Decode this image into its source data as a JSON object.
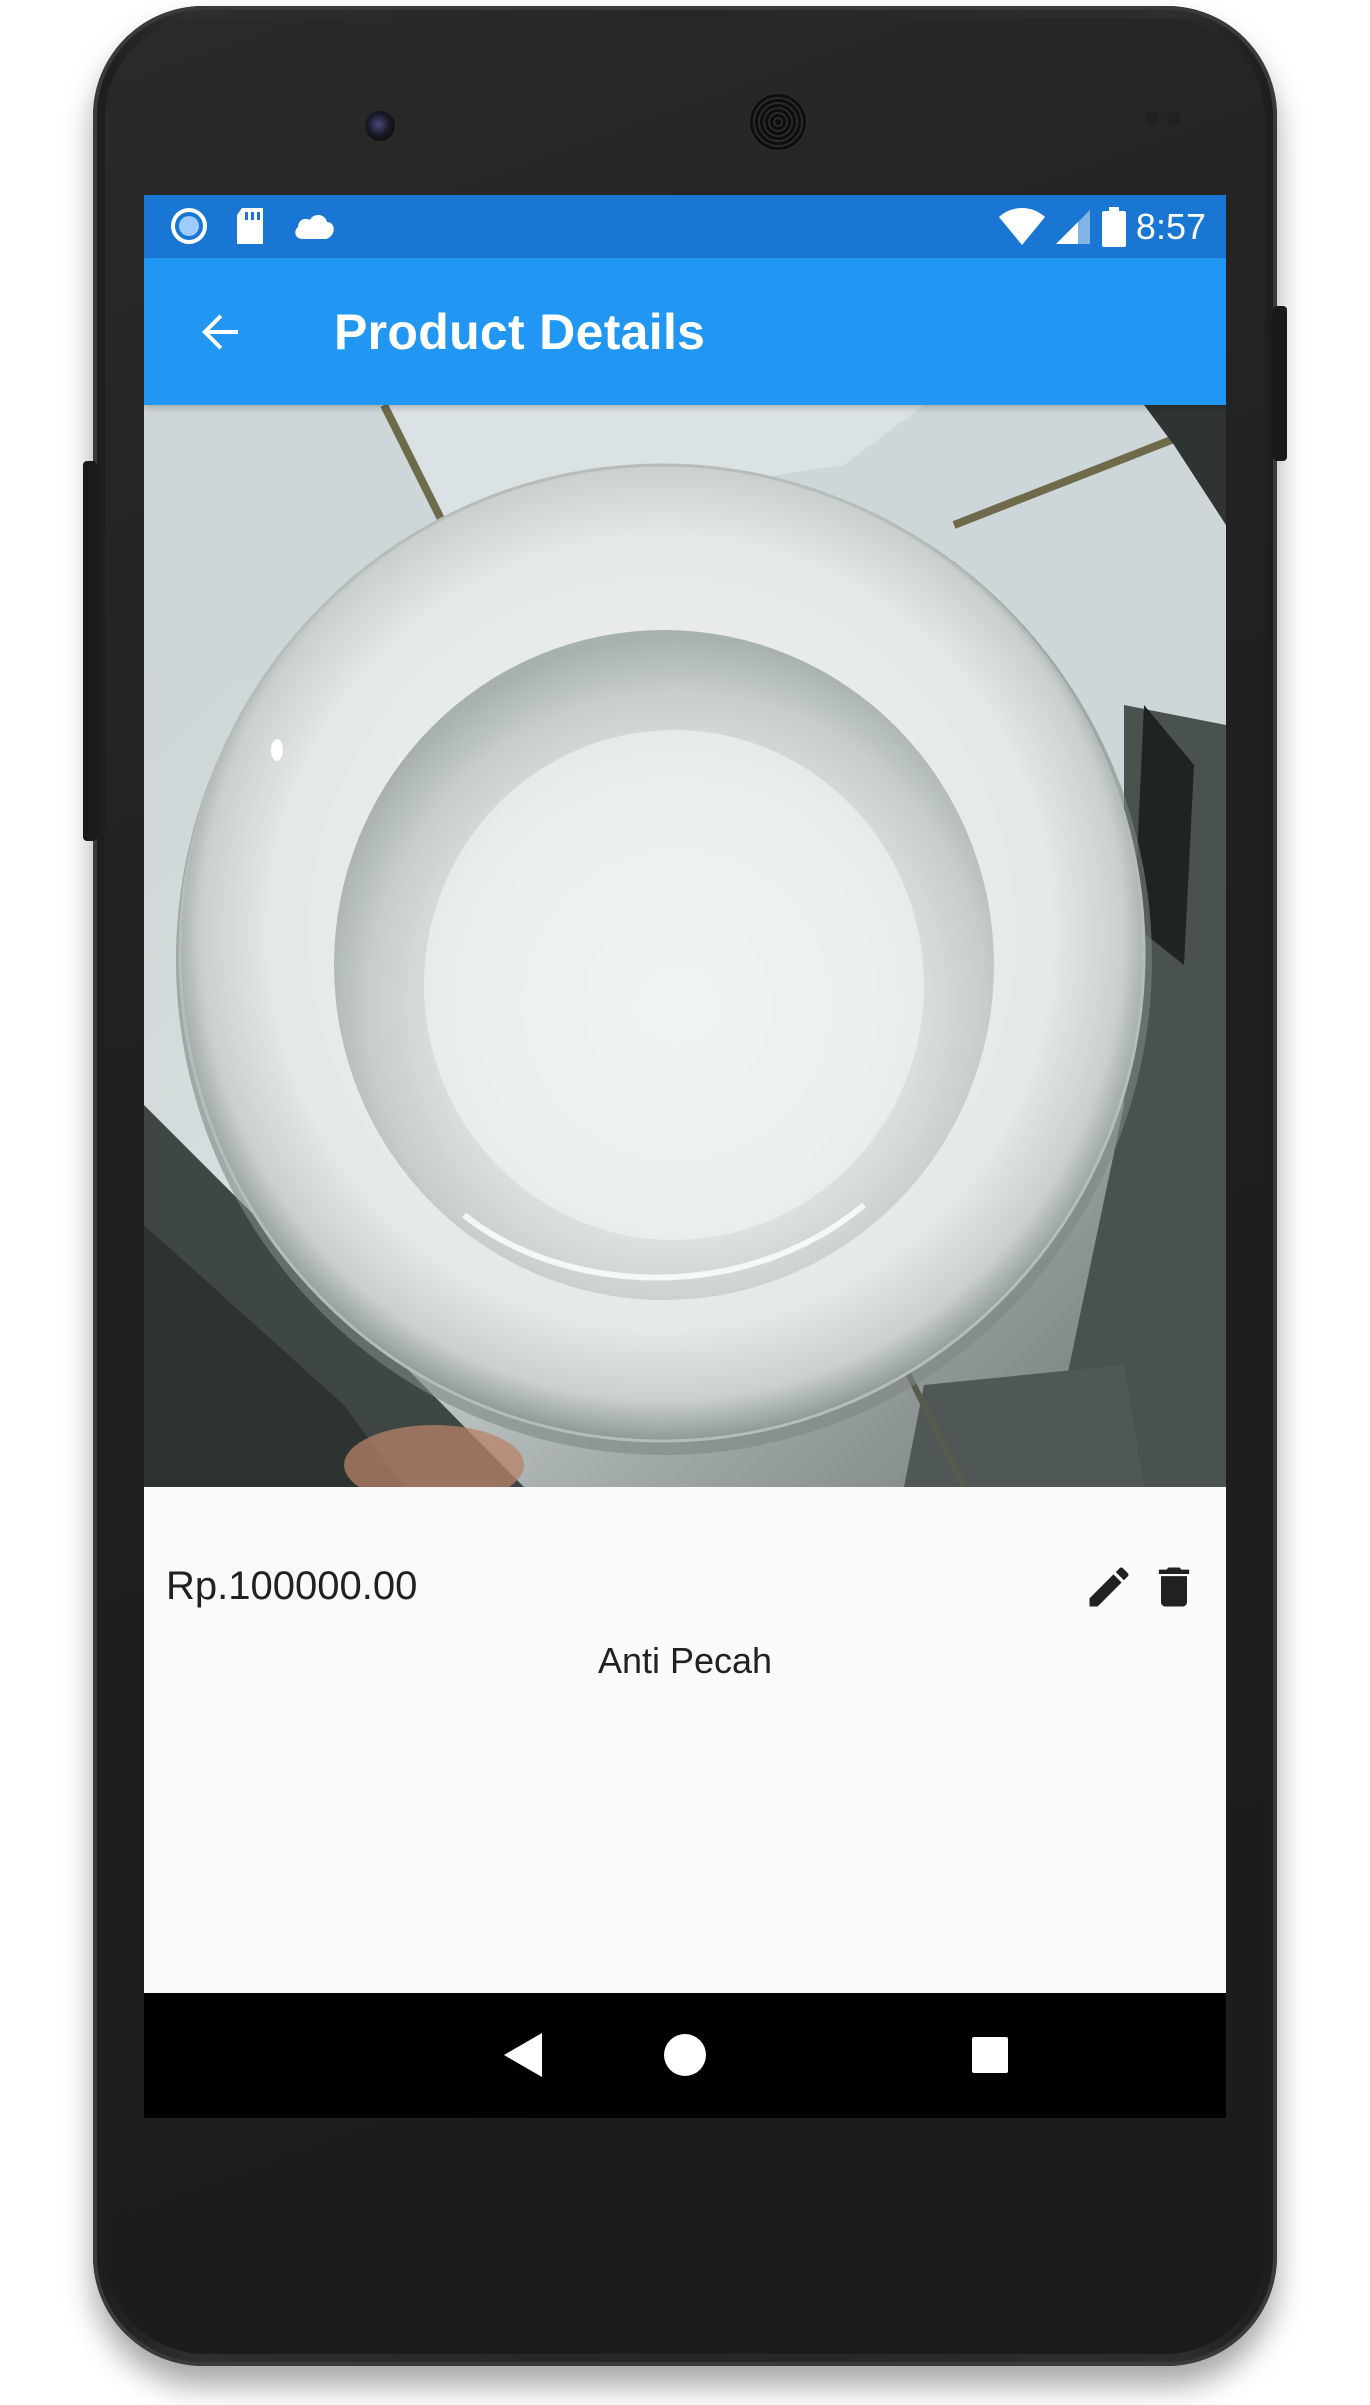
{
  "status_bar": {
    "time": "8:57",
    "left_icons": [
      "sync-circle-icon",
      "sd-card-icon",
      "cloud-icon"
    ],
    "right_icons": [
      "wifi-icon",
      "cell-signal-icon",
      "battery-icon"
    ]
  },
  "app_bar": {
    "back_icon": "arrow-left-icon",
    "title": "Product Details",
    "color": "#2196f3",
    "status_color": "#1976d2"
  },
  "product": {
    "image": "white-plate-photo",
    "price": "Rp.100000.00",
    "description": "Anti Pecah",
    "actions": [
      "pencil-icon",
      "trash-icon"
    ]
  },
  "nav_bar": {
    "buttons": [
      "back-triangle-icon",
      "home-circle-icon",
      "recents-square-icon"
    ]
  }
}
